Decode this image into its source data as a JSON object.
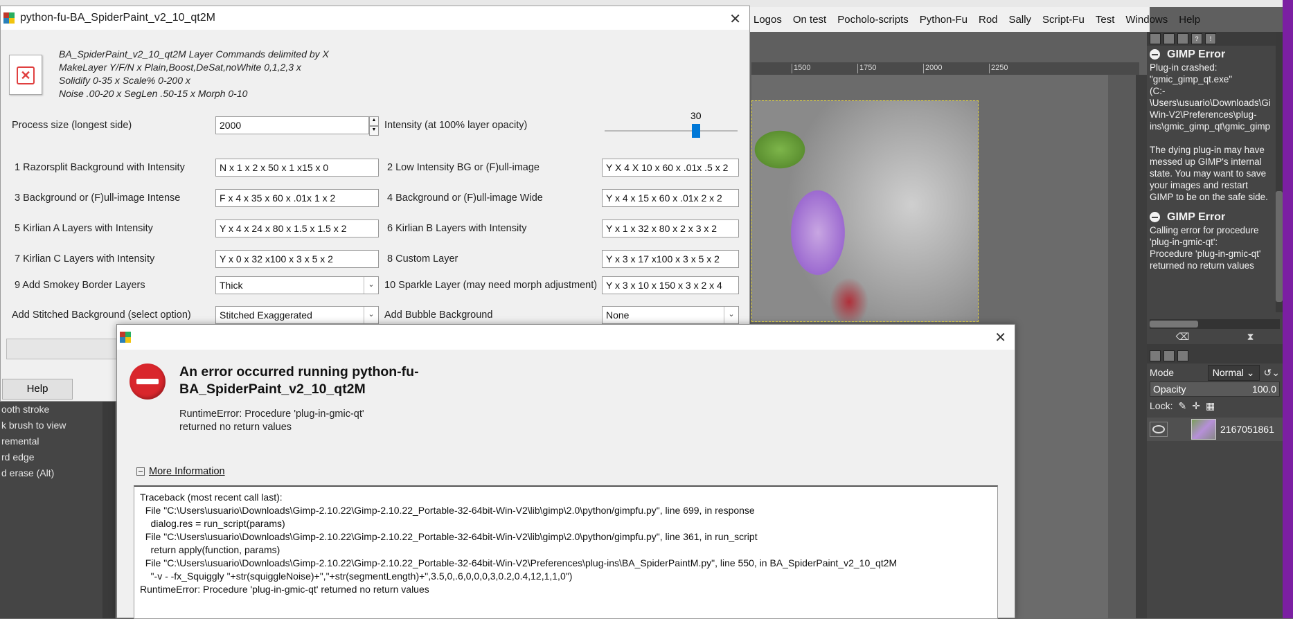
{
  "gimp": {
    "menubar": [
      "Logos",
      "On test",
      "Pocholo-scripts",
      "Python-Fu",
      "Rod",
      "Sally",
      "Script-Fu",
      "Test",
      "Windows",
      "Help"
    ],
    "ruler_ticks": [
      "1500",
      "1750",
      "2000",
      "2250"
    ],
    "tool_options": [
      "ooth stroke",
      "k brush to view",
      "remental",
      "rd edge",
      "d erase  (Alt)"
    ],
    "dock": {
      "errors": [
        {
          "title": "GIMP Error",
          "lines": [
            "Plug-in crashed:",
            "\"gmic_gimp_qt.exe\"",
            "(C:-",
            "\\Users\\usuario\\Downloads\\Gi",
            "Win-V2\\Preferences\\plug-",
            "ins\\gmic_gimp_qt\\gmic_gimp",
            "",
            "The dying plug-in may have",
            "messed up GIMP's internal",
            "state. You may want to save",
            "your images and restart",
            "GIMP to be on the safe side."
          ]
        },
        {
          "title": "GIMP Error",
          "lines": [
            "Calling error for procedure",
            "'plug-in-gmic-qt':",
            "Procedure 'plug-in-gmic-qt'",
            "returned no return values"
          ]
        }
      ],
      "mode_label": "Mode",
      "mode_value": "Normal",
      "opacity_label": "Opacity",
      "opacity_value": "100.0",
      "lock_label": "Lock:",
      "layer_name": "2167051861"
    }
  },
  "plugin": {
    "title": "python-fu-BA_SpiderPaint_v2_10_qt2M",
    "description": [
      "BA_SpiderPaint_v2_10_qt2M Layer Commands delimited by X",
      "MakeLayer Y/F/N x Plain,Boost,DeSat,noWhite 0,1,2,3 x",
      "Solidify 0-35 x Scale% 0-200 x",
      "Noise .00-20 x SegLen .50-15 x Morph 0-10"
    ],
    "process_size_label": "Process size (longest side)",
    "process_size_value": "2000",
    "intensity_label": "Intensity (at 100% layer opacity)",
    "intensity_value": "30",
    "intensity_fraction": 0.7,
    "rows": [
      {
        "l1": "1 Razorsplit Background with Intensity",
        "v1": "N x 1 x  2 x 50 x 1  x15  x 0",
        "l2": "2 Low Intensity BG or (F)ull-image",
        "v2": "Y X 4 X 10 x 60 x  .01x  .5 x 2"
      },
      {
        "l1": "3 Background or (F)ull-image Intense",
        "v1": "F x 4 x 35 x 60 x  .01x 1  x 2",
        "l2": "4 Background or (F)ull-image Wide",
        "v2": "Y x 4 x 15 x 60 x  .01x 2  x 2"
      },
      {
        "l1": "5 Kirlian A Layers with Intensity",
        "v1": "Y x 4 x 24 x 80 x 1.5 x 1.5 x 2",
        "l2": "6 Kirlian B Layers with Intensity",
        "v2": "Y x 1 x 32 x 80 x 2  x 3  x 2"
      },
      {
        "l1": "7 Kirlian C Layers with Intensity",
        "v1": "Y x 0 x 32 x100 x 3  x 5  x 2",
        "l2": "8 Custom Layer",
        "v2": "Y x 3 x 17 x100 x 3  x 5  x 2"
      }
    ],
    "smokey_label": "9 Add Smokey Border Layers",
    "smokey_value": "Thick",
    "sparkle_label": "10 Sparkle Layer (may need morph adjustment)",
    "sparkle_value": "Y x 3 x 10 x 150 x 3  x 2  x 4",
    "stitched_label": "Add Stitched Background (select option)",
    "stitched_value": "Stitched Exaggerated",
    "bubble_label": "Add Bubble Background",
    "bubble_value": "None",
    "help_label": "Help"
  },
  "error_dialog": {
    "heading": "An error occurred running python-fu-BA_SpiderPaint_v2_10_qt2M",
    "message": "RuntimeError: Procedure 'plug-in-gmic-qt' returned no return values",
    "more_info_label": "More Information",
    "traceback": [
      "Traceback (most recent call last):",
      "  File \"C:\\Users\\usuario\\Downloads\\Gimp-2.10.22\\Gimp-2.10.22_Portable-32-64bit-Win-V2\\lib\\gimp\\2.0\\python/gimpfu.py\", line 699, in response",
      "    dialog.res = run_script(params)",
      "  File \"C:\\Users\\usuario\\Downloads\\Gimp-2.10.22\\Gimp-2.10.22_Portable-32-64bit-Win-V2\\lib\\gimp\\2.0\\python/gimpfu.py\", line 361, in run_script",
      "    return apply(function, params)",
      "  File \"C:\\Users\\usuario\\Downloads\\Gimp-2.10.22\\Gimp-2.10.22_Portable-32-64bit-Win-V2\\Preferences\\plug-ins\\BA_SpiderPaintM.py\", line 550, in BA_SpiderPaint_v2_10_qt2M",
      "    \"-v - -fx_Squiggly \"+str(squiggleNoise)+\",\"+str(segmentLength)+\",3.5,0,.6,0,0,0,3,0.2,0.4,12,1,1,0\")",
      "RuntimeError: Procedure 'plug-in-gmic-qt' returned no return values"
    ]
  }
}
